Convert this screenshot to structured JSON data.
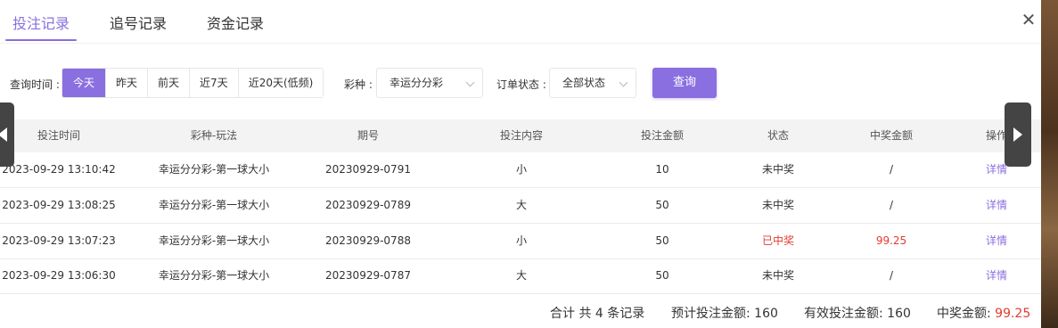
{
  "tabs": [
    {
      "label": "投注记录",
      "active": true
    },
    {
      "label": "追号记录",
      "active": false
    },
    {
      "label": "资金记录",
      "active": false
    }
  ],
  "filters": {
    "time_label": "查询时间 :",
    "time_options": [
      "今天",
      "昨天",
      "前天",
      "近7天",
      "近20天(低频)"
    ],
    "time_selected": "今天",
    "lottery_label": "彩种 :",
    "lottery_value": "幸运分分彩",
    "status_label": "订单状态 :",
    "status_value": "全部状态",
    "query_button": "查询"
  },
  "table": {
    "columns": [
      "投注时间",
      "彩种-玩法",
      "期号",
      "投注内容",
      "投注金额",
      "状态",
      "中奖金额",
      "操作"
    ],
    "rows": [
      {
        "time": "2023-09-29 13:10:42",
        "game": "幸运分分彩-第一球大小",
        "issue": "20230929-0791",
        "content": "小",
        "amount": "10",
        "status": "未中奖",
        "win": "/",
        "action": "详情"
      },
      {
        "time": "2023-09-29 13:08:25",
        "game": "幸运分分彩-第一球大小",
        "issue": "20230929-0789",
        "content": "大",
        "amount": "50",
        "status": "未中奖",
        "win": "/",
        "action": "详情"
      },
      {
        "time": "2023-09-29 13:07:23",
        "game": "幸运分分彩-第一球大小",
        "issue": "20230929-0788",
        "content": "小",
        "amount": "50",
        "status": "已中奖",
        "win": "99.25",
        "action": "详情"
      },
      {
        "time": "2023-09-29 13:06:30",
        "game": "幸运分分彩-第一球大小",
        "issue": "20230929-0787",
        "content": "大",
        "amount": "50",
        "status": "未中奖",
        "win": "/",
        "action": "详情"
      }
    ]
  },
  "summary": {
    "total_records": "合计 共 4 条记录",
    "expected_label": "预计投注金额: ",
    "expected_value": "160",
    "valid_label": "有效投注金额: ",
    "valid_value": "160",
    "win_label": "中奖金额: ",
    "win_value": "99.25"
  },
  "icons": {
    "close": "close-icon",
    "prev": "arrow-left-icon",
    "next": "arrow-right-icon"
  },
  "colors": {
    "accent": "#8a6fe0",
    "win_red": "#e23b30"
  }
}
